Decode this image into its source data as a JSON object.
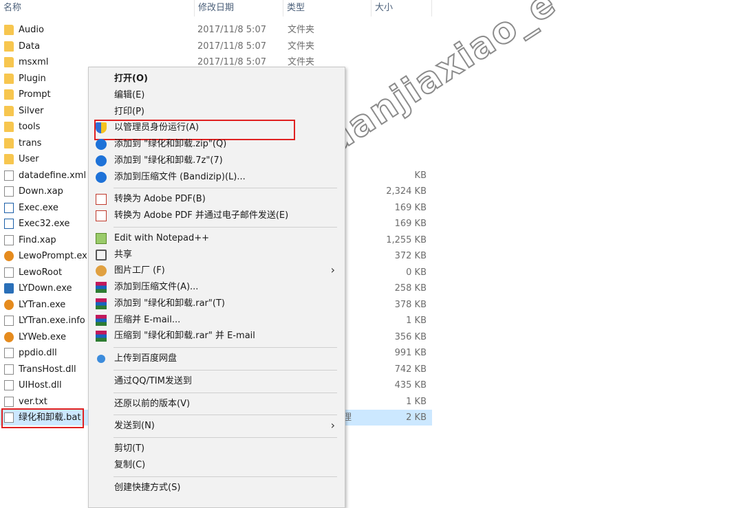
{
  "columns": {
    "name": "名称",
    "date": "修改日期",
    "type": "类型",
    "size": "大小"
  },
  "files": [
    {
      "name": "Audio",
      "date": "2017/11/8 5:07",
      "type": "文件夹",
      "size": "",
      "icon": "folder-icon"
    },
    {
      "name": "Data",
      "date": "2017/11/8 5:07",
      "type": "文件夹",
      "size": "",
      "icon": "folder-icon"
    },
    {
      "name": "msxml",
      "date": "2017/11/8 5:07",
      "type": "文件夹",
      "size": "",
      "icon": "folder-icon"
    },
    {
      "name": "Plugin",
      "date": "",
      "type": "",
      "size": "",
      "icon": "folder-icon"
    },
    {
      "name": "Prompt",
      "date": "",
      "type": "",
      "size": "",
      "icon": "folder-icon"
    },
    {
      "name": "Silver",
      "date": "",
      "type": "",
      "size": "",
      "icon": "folder-icon"
    },
    {
      "name": "tools",
      "date": "",
      "type": "",
      "size": "",
      "icon": "folder-icon"
    },
    {
      "name": "trans",
      "date": "",
      "type": "",
      "size": "",
      "icon": "folder-icon"
    },
    {
      "name": "User",
      "date": "",
      "type": "",
      "size": "",
      "icon": "folder-icon"
    },
    {
      "name": "datadefine.xml",
      "date": "",
      "type": "",
      "size": "KB",
      "icon": "file-icon"
    },
    {
      "name": "Down.xap",
      "date": "",
      "type": "",
      "size": "2,324 KB",
      "icon": "file-icon"
    },
    {
      "name": "Exec.exe",
      "date": "",
      "type": "",
      "size": "169 KB",
      "icon": "exe-icon"
    },
    {
      "name": "Exec32.exe",
      "date": "",
      "type": "",
      "size": "169 KB",
      "icon": "exe-icon"
    },
    {
      "name": "Find.xap",
      "date": "",
      "type": "",
      "size": "1,255 KB",
      "icon": "file-icon"
    },
    {
      "name": "LewoPrompt.ex",
      "date": "",
      "type": "",
      "size": "372 KB",
      "icon": "lewo-icon"
    },
    {
      "name": "LewoRoot",
      "date": "",
      "type": "",
      "size": "0 KB",
      "icon": "file-icon"
    },
    {
      "name": "LYDown.exe",
      "date": "",
      "type": "",
      "size": "258 KB",
      "icon": "lydown-icon"
    },
    {
      "name": "LYTran.exe",
      "date": "",
      "type": "",
      "size": "378 KB",
      "icon": "lewo-icon"
    },
    {
      "name": "LYTran.exe.info",
      "date": "",
      "type": "",
      "size": "1 KB",
      "icon": "file-icon"
    },
    {
      "name": "LYWeb.exe",
      "date": "",
      "type": "",
      "size": "356 KB",
      "icon": "lewo-icon"
    },
    {
      "name": "ppdio.dll",
      "date": "",
      "type": "",
      "size": "991 KB",
      "icon": "dll-icon"
    },
    {
      "name": "TransHost.dll",
      "date": "",
      "type": "",
      "size": "742 KB",
      "icon": "dll-icon"
    },
    {
      "name": "UIHost.dll",
      "date": "",
      "type": "",
      "size": "435 KB",
      "icon": "dll-icon"
    },
    {
      "name": "ver.txt",
      "date": "",
      "type": "",
      "size": "1 KB",
      "icon": "txt-icon"
    },
    {
      "name": "绿化和卸载.bat",
      "date": "",
      "type": "理",
      "size": "2 KB",
      "icon": "bat-icon",
      "selected": true
    }
  ],
  "menu": [
    {
      "label": "打开(O)",
      "bold": true,
      "icon": ""
    },
    {
      "label": "编辑(E)",
      "icon": ""
    },
    {
      "label": "打印(P)",
      "icon": ""
    },
    {
      "label": "以管理员身份运行(A)",
      "icon": "shield-icon"
    },
    {
      "label": "添加到 \"绿化和卸载.zip\"(Q)",
      "icon": "bandizip-icon"
    },
    {
      "label": "添加到 \"绿化和卸载.7z\"(7)",
      "icon": "bandizip-icon"
    },
    {
      "label": "添加到压缩文件 (Bandizip)(L)...",
      "icon": "bandizip-icon"
    },
    {
      "sep": true
    },
    {
      "label": "转换为 Adobe PDF(B)",
      "icon": "pdf-icon"
    },
    {
      "label": "转换为 Adobe PDF 并通过电子邮件发送(E)",
      "icon": "pdf-mail-icon"
    },
    {
      "sep": true
    },
    {
      "label": "Edit with Notepad++",
      "icon": "notepad-icon"
    },
    {
      "label": "共享",
      "icon": "share-icon"
    },
    {
      "label": "图片工厂 (F)",
      "icon": "picture-factory-icon",
      "submenu": true
    },
    {
      "label": "添加到压缩文件(A)...",
      "icon": "winrar-icon"
    },
    {
      "label": "添加到 \"绿化和卸载.rar\"(T)",
      "icon": "winrar-icon"
    },
    {
      "label": "压缩并 E-mail...",
      "icon": "winrar-icon"
    },
    {
      "label": "压缩到 \"绿化和卸载.rar\" 并 E-mail",
      "icon": "winrar-icon"
    },
    {
      "sep": true
    },
    {
      "label": "上传到百度网盘",
      "icon": "baidu-icon"
    },
    {
      "sep": true
    },
    {
      "label": "通过QQ/TIM发送到",
      "icon": ""
    },
    {
      "sep": true
    },
    {
      "label": "还原以前的版本(V)",
      "icon": ""
    },
    {
      "sep": true
    },
    {
      "label": "发送到(N)",
      "icon": "",
      "submenu": true
    },
    {
      "sep": true
    },
    {
      "label": "剪切(T)",
      "icon": ""
    },
    {
      "label": "复制(C)",
      "icon": ""
    },
    {
      "sep": true
    },
    {
      "label": "创建快捷方式(S)",
      "icon": ""
    }
  ],
  "watermark": "微信公众号：guanjiaxiao_e",
  "arrow": "›"
}
